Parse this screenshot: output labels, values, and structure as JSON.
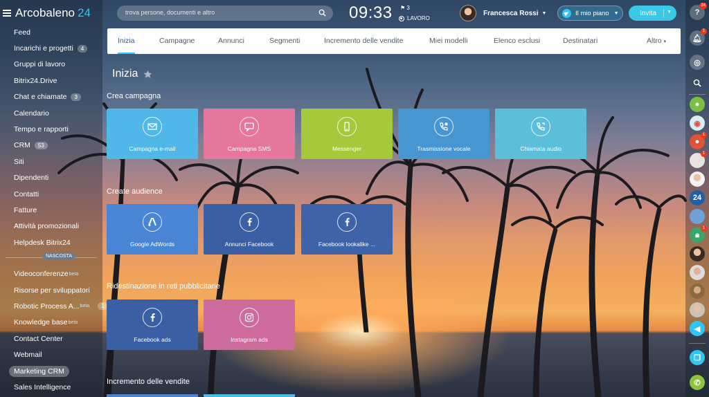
{
  "app": {
    "logo_name": "Arcobaleno",
    "logo_number": "24"
  },
  "sidebar": {
    "items": [
      {
        "label": "Feed"
      },
      {
        "label": "Incarichi e progetti",
        "counter": "4"
      },
      {
        "label": "Gruppi di lavoro"
      },
      {
        "label": "Bitrix24.Drive"
      },
      {
        "label": "Chat e chiamate",
        "counter": "3"
      },
      {
        "label": "Calendario"
      },
      {
        "label": "Tempo e rapporti"
      },
      {
        "label": "CRM",
        "counter": "53"
      },
      {
        "label": "Siti"
      },
      {
        "label": "Dipendenti"
      },
      {
        "label": "Contatti"
      },
      {
        "label": "Fatture"
      },
      {
        "label": "Attività promozionali"
      },
      {
        "label": "Helpdesk Bitrix24"
      }
    ],
    "hidden_label": "NASCOSTA",
    "hidden_items": [
      {
        "label": "Videoconferenze",
        "sup": "beta"
      },
      {
        "label": "Risorse per sviluppatori"
      },
      {
        "label": "Robotic Process A...",
        "sup": "beta",
        "counter": "1"
      },
      {
        "label": "Knowledge base",
        "sup": "beta"
      },
      {
        "label": "Contact Center"
      },
      {
        "label": "Webmail"
      },
      {
        "label": "Marketing CRM",
        "active": true
      },
      {
        "label": "Sales Intelligence"
      }
    ]
  },
  "header": {
    "search_placeholder": "trova persone, documenti e altro",
    "clock": "09:33",
    "flag_count": "3",
    "work_status": "LAVORO",
    "user_name": "Francesca Rossi",
    "plan_label": "Il mio piano",
    "invite_label": "Invita"
  },
  "tabs": [
    {
      "label": "Inizia",
      "active": true
    },
    {
      "label": "Campagne"
    },
    {
      "label": "Annunci"
    },
    {
      "label": "Segmenti"
    },
    {
      "label": "Incremento delle vendite"
    },
    {
      "label": "Miei modelli"
    },
    {
      "label": "Elenco esclusi"
    },
    {
      "label": "Destinatari"
    },
    {
      "label": "Altro"
    }
  ],
  "page": {
    "title": "Inizia",
    "sections": [
      {
        "title": "Crea campagna",
        "tiles": [
          {
            "label": "Campagna e-mail",
            "icon": "email-icon",
            "color": "#4fb8e8"
          },
          {
            "label": "Campagna SMS",
            "icon": "sms-icon",
            "color": "#e4779b"
          },
          {
            "label": "Messenger",
            "icon": "messenger-icon",
            "color": "#a4c93b"
          },
          {
            "label": "Trasmissione vocale",
            "icon": "voice-broadcast-icon",
            "color": "#4796d1"
          },
          {
            "label": "Chiamata audio",
            "icon": "audio-call-icon",
            "color": "#5bbfd9"
          }
        ]
      },
      {
        "title": "Create audience",
        "tiles": [
          {
            "label": "Google AdWords",
            "icon": "adwords-icon",
            "color": "#4a85d5"
          },
          {
            "label": "Annunci Facebook",
            "icon": "facebook-icon",
            "color": "#3b5fa4"
          },
          {
            "label": "Facebook lookalike ...",
            "icon": "facebook-icon",
            "color": "#3f63a8"
          }
        ]
      },
      {
        "title": "Ridestinazione in reti pubblicitarie",
        "tiles": [
          {
            "label": "Facebook ads",
            "icon": "facebook-icon",
            "color": "#3b5fa4"
          },
          {
            "label": "Instagram ads",
            "icon": "instagram-icon",
            "color": "#cd6b9d"
          }
        ]
      },
      {
        "title": "Incremento delle vendite",
        "tiles": []
      }
    ]
  },
  "rightbar": {
    "help_badge": "24",
    "notifications_badge": "1",
    "contact_badge_1": "1",
    "contact_badge_2": "1",
    "contact_badge_3": "1",
    "workgroup_label": "24"
  }
}
